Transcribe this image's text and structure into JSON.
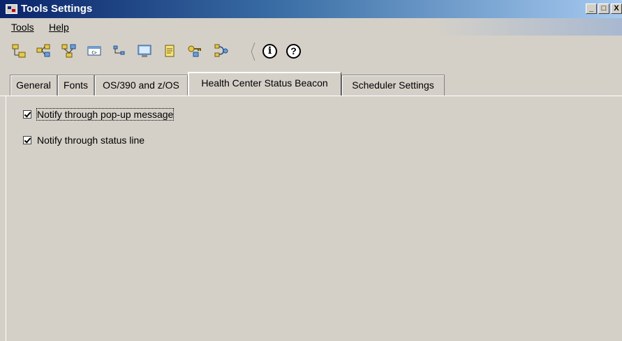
{
  "window": {
    "title": "Tools Settings",
    "controls": {
      "minimize": "_",
      "maximize": "□",
      "close": "X"
    }
  },
  "menubar": {
    "items": [
      {
        "label": "Tools",
        "mnemonic": "T"
      },
      {
        "label": "Help",
        "mnemonic": "H"
      }
    ]
  },
  "toolbar": {
    "icons": [
      "tree-view-icon",
      "multi-tree-icon",
      "related-tree-icon",
      "command-icon",
      "topology-icon",
      "monitor-icon",
      "notepad-icon",
      "key-icon",
      "connection-icon"
    ],
    "info_glyph": "i",
    "help_glyph": "?"
  },
  "tabs": [
    {
      "label": "General",
      "active": false
    },
    {
      "label": "Fonts",
      "active": false
    },
    {
      "label": "OS/390 and z/OS",
      "active": false
    },
    {
      "label": "Health Center Status Beacon",
      "active": true
    },
    {
      "label": "Scheduler Settings",
      "active": false
    }
  ],
  "options": [
    {
      "label": "Notify through pop-up message",
      "checked": true,
      "focused": true
    },
    {
      "label": "Notify through status line",
      "checked": true,
      "focused": false
    }
  ]
}
